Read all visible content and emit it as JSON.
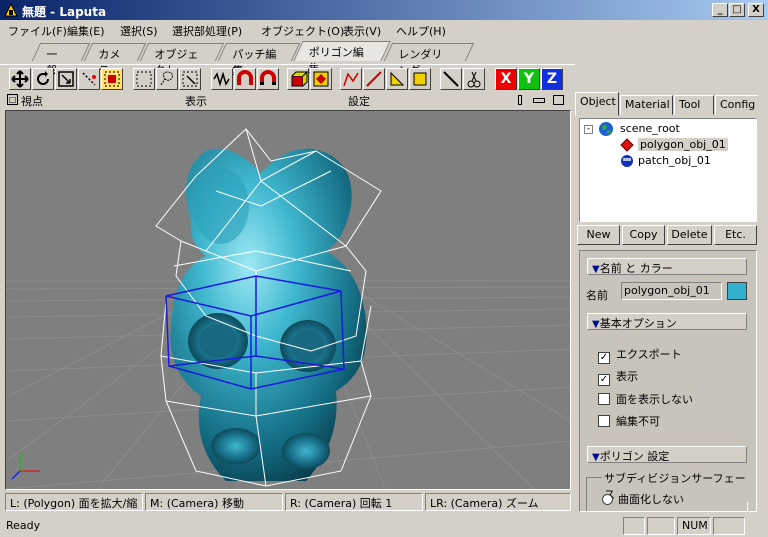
{
  "window": {
    "title": "無題 - Laputa",
    "min": "_",
    "max": "□",
    "close": "X"
  },
  "menu": [
    "ファイル(F)",
    "編集(E)",
    "選択(S)",
    "選択部処理(P)",
    "オブジェクト(O)",
    "表示(V)",
    "ヘルプ(H)"
  ],
  "tabs": [
    "一般",
    "カメラ",
    "オブジェクト",
    "パッチ編集",
    "ポリゴン編集",
    "レンダリング"
  ],
  "active_tab": "ポリゴン編集",
  "axis_buttons": {
    "x": "X",
    "y": "Y",
    "z": "Z"
  },
  "viewport_header": {
    "viewpoint": "視点",
    "display": "表示",
    "settings": "設定"
  },
  "mode_bar": [
    "L: (Polygon) 面を拡大/縮",
    "M: (Camera) 移動",
    "R: (Camera) 回転 1",
    "LR: (Camera) ズーム"
  ],
  "status": {
    "ready": "Ready",
    "num": "NUM"
  },
  "panel": {
    "tabs": [
      "Object",
      "Material",
      "Tool",
      "Config"
    ],
    "tree": {
      "root": "scene_root",
      "children": [
        "polygon_obj_01",
        "patch_obj_01"
      ]
    },
    "buttons": [
      "New",
      "Copy",
      "Delete",
      "Etc."
    ],
    "sections": {
      "name_color": "名前 と カラー",
      "name_label": "名前",
      "name_value": "polygon_obj_01",
      "basic": "基本オプション",
      "checks": [
        {
          "label": "エクスポート",
          "checked": true
        },
        {
          "label": "表示",
          "checked": true
        },
        {
          "label": "面を表示しない",
          "checked": false
        },
        {
          "label": "編集不可",
          "checked": false
        }
      ],
      "polygon": "ポリゴン 設定",
      "subdiv": "サブディビジョンサーフェース",
      "radio1": "曲面化しない"
    },
    "color_swatch": "#33b0cc"
  }
}
